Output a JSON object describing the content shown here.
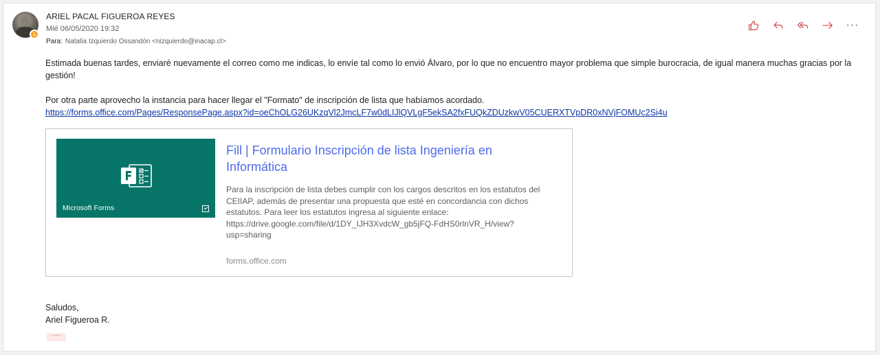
{
  "message": {
    "sender_name": "ARIEL PACAL FIGUEROA REYES",
    "date": "Mié 06/05/2020 19:32",
    "to_label": "Para:",
    "to_value": "Natalia Izquierdo Ossandón <nizquierdo@inacap.cl>",
    "presence_color": "#f8a11d"
  },
  "actions": {
    "like_icon": "like-icon",
    "reply_icon": "reply-icon",
    "reply_all_icon": "reply-all-icon",
    "forward_icon": "forward-icon",
    "more_label": "···",
    "accent_color": "#d13438"
  },
  "body": {
    "paragraph1": "Estimada buenas tardes, enviaré nuevamente el correo como me indicas, lo envíe tal como lo envió Álvaro, por lo que no encuentro mayor problema que simple burocracia, de igual manera muchas gracias por la gestión!",
    "paragraph2": "Por otra parte aprovecho la instancia para hacer llegar el \"Formato\" de inscripción de lista que habíamos acordado.",
    "link": "https://forms.office.com/Pages/ResponsePage.aspx?id=oeChOLG26UKzqVl2JmcLF7w0dLIJlQVLgF5ekSA2fxFUQkZDUzkwV05CUERXTVpDR0xNVjFOMUc2Si4u"
  },
  "preview": {
    "thumb_label": "Microsoft Forms",
    "thumb_color": "#077568",
    "title": "Fill | Formulario Inscripción de lista Ingeniería en Informática",
    "description": "Para la inscripción de lista debes cumplir con los cargos descritos en los estatutos del CEIIAP, además de presentar una propuesta que esté en concordancia con dichos estatutos. Para leer los estatutos ingresa al siguiente enlace: https://drive.google.com/file/d/1DY_IJH3XvdcW_gb5jFQ-FdHS0rlnVR_H/view?usp=sharing",
    "domain": "forms.office.com"
  },
  "signature": {
    "line1": "Saludos,",
    "line2": "Ariel Figueroa R."
  },
  "expand": {
    "label": "···"
  }
}
